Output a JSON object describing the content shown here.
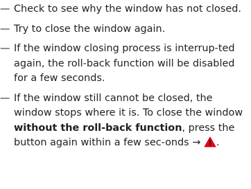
{
  "instructions": [
    {
      "dash": "—",
      "text": "Check to see why the window has not closed."
    },
    {
      "dash": "—",
      "text": "Try to close the window again."
    },
    {
      "dash": "—",
      "text": "If the window closing process is interrup-ted again, the roll-back function will be disabled for a few seconds."
    },
    {
      "dash": "—",
      "text_before": "If the window still cannot be closed, the window stops where it is. To close the window ",
      "bold_text": "without the roll-back function",
      "text_after": ", press the button again within a few sec-onds →",
      "icon": "warning-triangle-icon",
      "icon_color": "#e3001b",
      "icon_mark_color": "#111111"
    }
  ]
}
